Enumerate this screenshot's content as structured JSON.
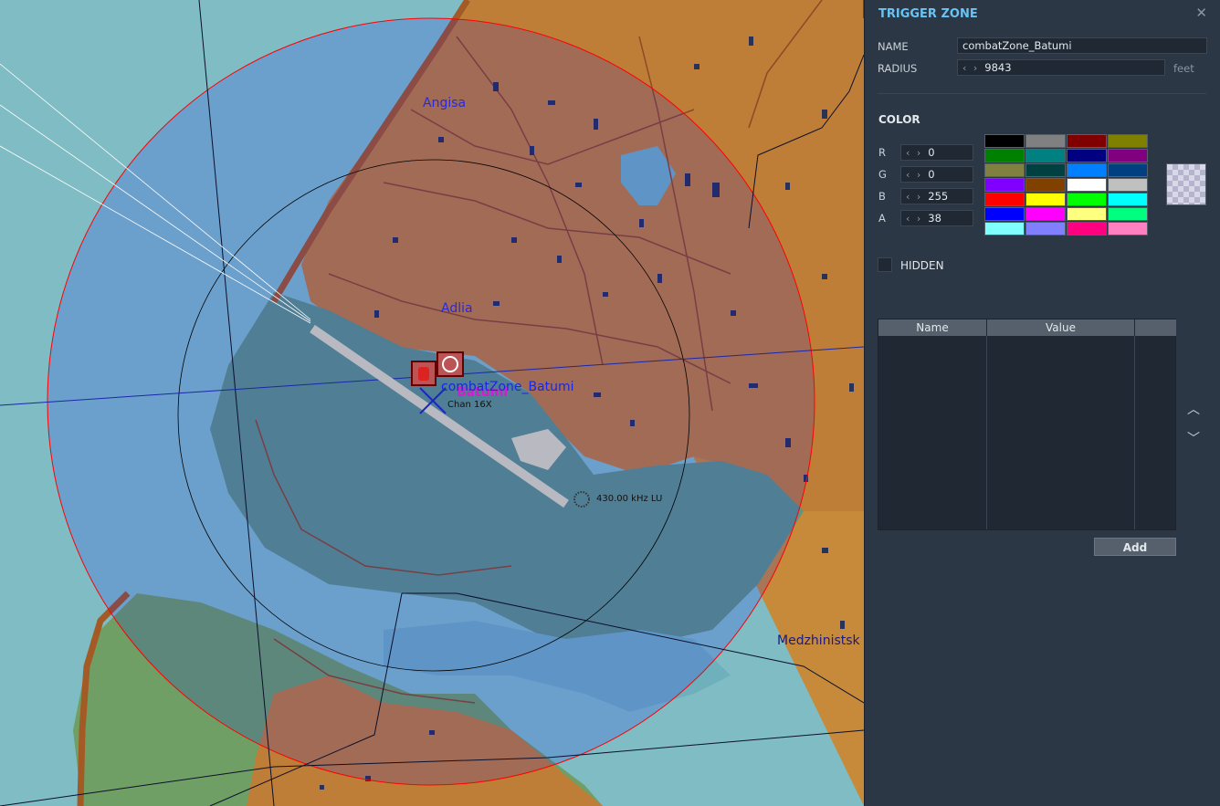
{
  "map": {
    "labels": {
      "angisa": "Angisa",
      "adlia": "Adlia",
      "zone_name": "combatZone_Batumi",
      "airbase": "Batumi",
      "chan": "Chan 16X",
      "ndb": "430.00 kHz LU",
      "medzh": "Medzhinistsk"
    }
  },
  "panel": {
    "title": "TRIGGER ZONE",
    "close_icon": "close-icon",
    "name_label": "NAME",
    "name_value": "combatZone_Batumi",
    "radius_label": "RADIUS",
    "radius_value": "9843",
    "radius_unit": "feet",
    "color_heading": "COLOR",
    "channels": [
      {
        "label": "R",
        "value": "0"
      },
      {
        "label": "G",
        "value": "0"
      },
      {
        "label": "B",
        "value": "255"
      },
      {
        "label": "A",
        "value": "38"
      }
    ],
    "palette": [
      "#000000",
      "#808080",
      "#800000",
      "#808000",
      "#008000",
      "#008080",
      "#000080",
      "#800080",
      "#808040",
      "#004040",
      "#0080ff",
      "#004080",
      "#8000ff",
      "#804000",
      "#ffffff",
      "#c0c0c0",
      "#ff0000",
      "#ffff00",
      "#00ff00",
      "#00ffff",
      "#0000ff",
      "#ff00ff",
      "#ffff80",
      "#00ff80",
      "#80ffff",
      "#8080ff",
      "#ff0080",
      "#ff80c0"
    ],
    "hidden_label": "HIDDEN",
    "table": {
      "col_name": "Name",
      "col_value": "Value"
    },
    "up_icon": "chevron-up-icon",
    "down_icon": "chevron-down-icon",
    "add_label": "Add"
  }
}
